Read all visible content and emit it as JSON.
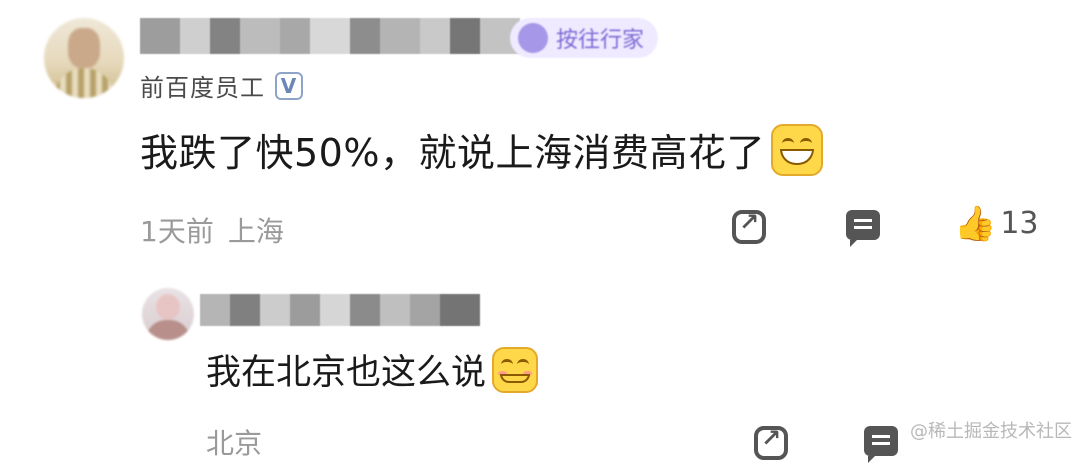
{
  "main_comment": {
    "tag": "按往行家",
    "subtitle": "前百度员工",
    "verified_badge": "V",
    "text": "我跌了快50%，就说上海消费高花了",
    "time": "1天前",
    "location": "上海",
    "like_count": "13"
  },
  "reply": {
    "text": "我在北京也这么说",
    "location": "北京"
  },
  "icons": {
    "share": "share-icon",
    "comment": "comment-icon",
    "like": "thumbs-up-icon",
    "emoji": "grin-emoji-icon"
  },
  "watermark": "@稀土掘金技术社区"
}
